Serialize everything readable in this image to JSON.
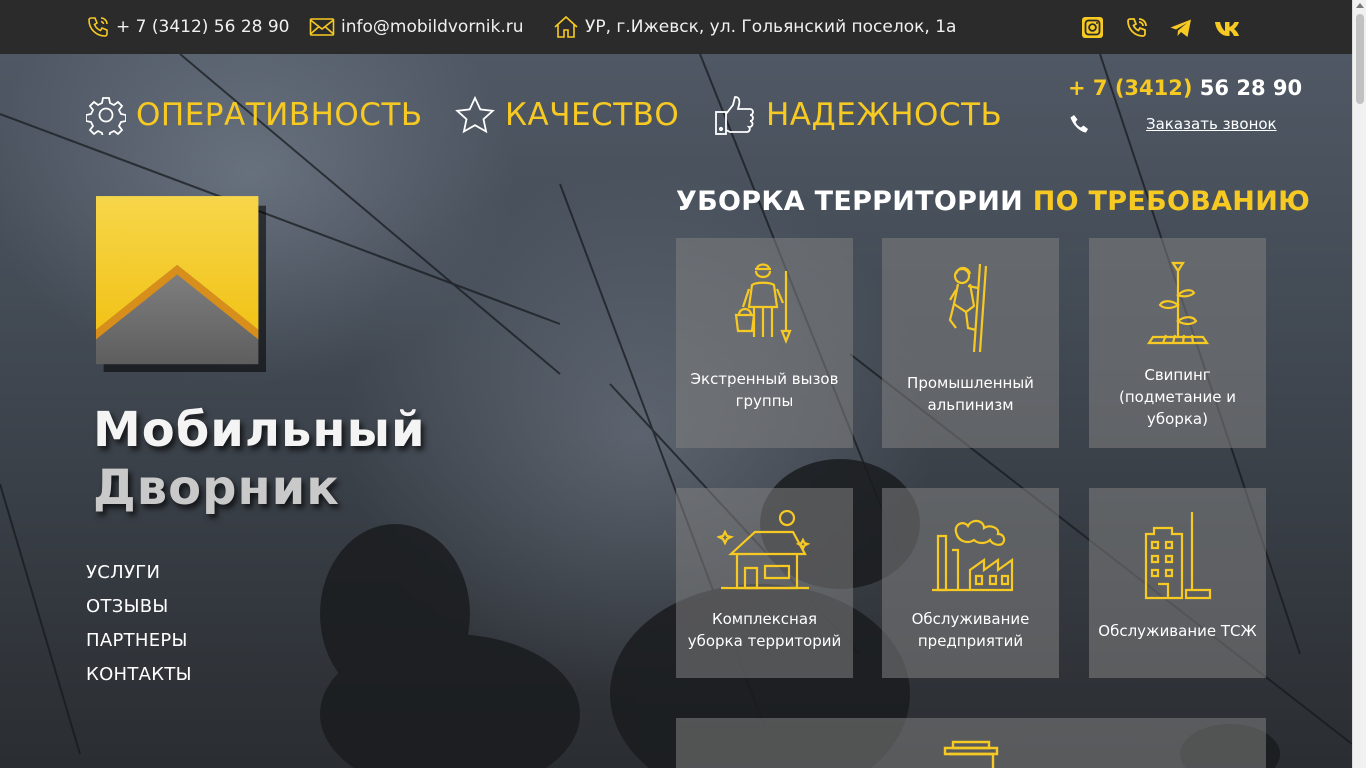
{
  "topbar": {
    "phone": "+ 7 (3412) 56 28 90",
    "email": "info@mobildvornik.ru",
    "address": "УР, г.Ижевск, ул. Гольянский поселок, 1а",
    "social": [
      "instagram-icon",
      "viber-icon",
      "telegram-icon",
      "vk-icon"
    ]
  },
  "features": [
    {
      "label": "ОПЕРАТИВНОСТЬ",
      "icon": "gear-icon"
    },
    {
      "label": "КАЧЕСТВО",
      "icon": "star-icon"
    },
    {
      "label": "НАДЕЖНОСТЬ",
      "icon": "thumbs-up-icon"
    }
  ],
  "header": {
    "phone_code": "+ 7 (3412)",
    "phone_number": "56 28 90",
    "callback_label": "Заказать звонок"
  },
  "brand": {
    "line1": "Мобильный",
    "line2": "Дворник"
  },
  "nav": [
    "УСЛУГИ",
    "ОТЗЫВЫ",
    "ПАРТНЕРЫ",
    "КОНТАКТЫ"
  ],
  "services": {
    "title_white": "УБОРКА ТЕРРИТОРИИ",
    "title_yellow": "ПО ТРЕБОВАНИЮ",
    "cards": [
      {
        "label": "Экстренный вызов группы",
        "icon": "janitor-icon"
      },
      {
        "label": "Промышленный альпинизм",
        "icon": "climber-icon"
      },
      {
        "label": "Свипинг (подметание и уборка)",
        "icon": "rake-icon"
      },
      {
        "label": "Комплексная уборка территорий",
        "icon": "house-icon"
      },
      {
        "label": "Обслуживание предприятий",
        "icon": "factory-icon"
      },
      {
        "label": "Обслуживание ТСЖ",
        "icon": "apartment-icon"
      }
    ]
  },
  "colors": {
    "accent": "#f7c923",
    "topbar": "#2b2b2b",
    "card": "rgba(128,128,128,0.55)"
  }
}
